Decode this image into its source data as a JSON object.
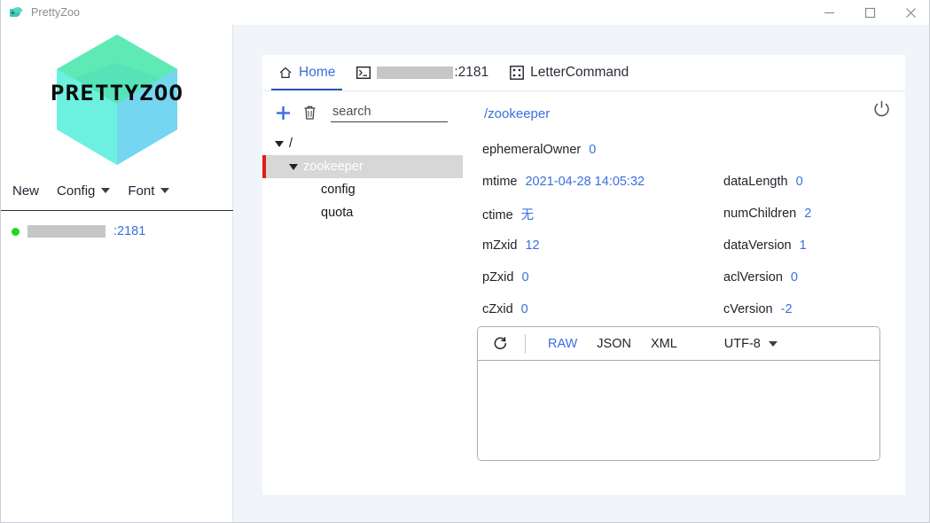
{
  "window": {
    "title": "PrettyZoo",
    "app_icon": "bird-icon",
    "controls": {
      "minimize": "minimize-icon",
      "maximize": "maximize-icon",
      "close": "close-icon"
    }
  },
  "sidebar": {
    "logo_text": "PRETTYZOO",
    "logo_colors": {
      "top_left": "#5ee9b5",
      "top_right": "#6fd8ef",
      "center": "#3ec8dd",
      "bottom_left": "#6ef0e0",
      "bottom_right": "#7bd9f2"
    },
    "menu": [
      {
        "label": "New",
        "has_caret": false
      },
      {
        "label": "Config",
        "has_caret": true
      },
      {
        "label": "Font",
        "has_caret": true
      }
    ],
    "connections": [
      {
        "status": "online",
        "host_redacted": true,
        "port_label": ":2181"
      }
    ]
  },
  "tabs": [
    {
      "label": "Home",
      "icon": "home-icon",
      "active": true,
      "redacted_host": false
    },
    {
      "label": ":2181",
      "icon": "terminal-icon",
      "active": false,
      "redacted_host": true
    },
    {
      "label": "LetterCommand",
      "icon": "dice-icon",
      "active": false,
      "redacted_host": false
    }
  ],
  "tree_panel": {
    "add_label": "add-node",
    "delete_label": "delete-node",
    "search_placeholder": "search",
    "search_value": "",
    "nodes": [
      {
        "label": "/",
        "level": 0,
        "expanded": true,
        "selected": false
      },
      {
        "label": "zookeeper",
        "level": 1,
        "expanded": true,
        "selected": true
      },
      {
        "label": "config",
        "level": 2,
        "expanded": false,
        "selected": false
      },
      {
        "label": "quota",
        "level": 2,
        "expanded": false,
        "selected": false
      }
    ]
  },
  "detail": {
    "node_path": "/zookeeper",
    "power_icon": "power-icon",
    "properties_full": [
      {
        "key": "ephemeralOwner",
        "value": "0"
      }
    ],
    "properties": [
      {
        "left_key": "mtime",
        "left_value": "2021-04-28 14:05:32",
        "right_key": "dataLength",
        "right_value": "0"
      },
      {
        "left_key": "ctime",
        "left_value": "无",
        "right_key": "numChildren",
        "right_value": "2"
      },
      {
        "left_key": "mZxid",
        "left_value": "12",
        "right_key": "dataVersion",
        "right_value": "1"
      },
      {
        "left_key": "pZxid",
        "left_value": "0",
        "right_key": "aclVersion",
        "right_value": "0"
      },
      {
        "left_key": "cZxid",
        "left_value": "0",
        "right_key": "cVersion",
        "right_value": "-2"
      }
    ]
  },
  "data_panel": {
    "refresh_icon": "refresh-icon",
    "formats": [
      {
        "label": "RAW",
        "active": true
      },
      {
        "label": "JSON",
        "active": false
      },
      {
        "label": "XML",
        "active": false
      }
    ],
    "encoding": "UTF-8",
    "content": "",
    "content_placeholder": ""
  },
  "colors": {
    "accent": "#3b6fe0",
    "tab_underline": "#3054b8",
    "selection_bg": "#d7d7d7",
    "selection_marker": "#e01b1b",
    "online_dot": "#1ed81e",
    "redaction": "#c6c6c6",
    "main_bg": "#f1f5f9"
  }
}
